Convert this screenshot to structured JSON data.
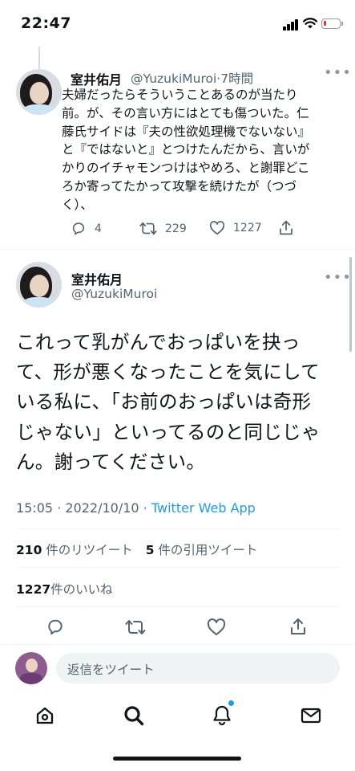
{
  "status_bar": {
    "time": "22:47"
  },
  "quoted_tweet": {
    "display_name": "室井佑月",
    "handle": "@YuzukiMuroi",
    "dot": "·",
    "time_ago": "7時間",
    "text_lines": [
      "夫婦だったらそういうことあるのが当たり",
      "前。が、その言い方にはとても傷ついた。仁",
      "藤氏サイドは『夫の性欲処理機でないない』",
      "と『ではないと』とつけたんだから、言いが",
      "かりのイチャモンつけはやめろ、と謝罪どこ",
      "ろか寄ってたかって攻撃を続けたが（つづ",
      "く）、"
    ],
    "reply_count": "4",
    "retweet_count": "229",
    "like_count": "1227"
  },
  "main_tweet": {
    "display_name": "室井佑月",
    "handle": "@YuzukiMuroi",
    "text_lines": [
      "これって乳がんでおっぱいを抉っ",
      "て、形が悪くなったことを気にして",
      "いる私に、「お前のおっぱいは奇形",
      "じゃない」といってるのと同じじゃ",
      "ん。謝ってください。"
    ],
    "time": "15:05",
    "separator": "·",
    "date": "2022/10/10",
    "source": "Twitter Web App",
    "retweets_value": "210",
    "retweets_label": "件のリツイート",
    "quotes_value": "5",
    "quotes_label": "件の引用ツイート",
    "likes_value": "1227",
    "likes_label": "件のいいね"
  },
  "reply_bar": {
    "placeholder": "返信をツイート"
  },
  "bottom_nav": {
    "items": [
      "home-icon",
      "search-icon",
      "notifications-icon",
      "messages-icon"
    ],
    "notification_dot_color": "#1d9bf0"
  },
  "colors": {
    "accent": "#1d9bf0",
    "secondary_text": "#536471",
    "primary_text": "#0f1419"
  }
}
